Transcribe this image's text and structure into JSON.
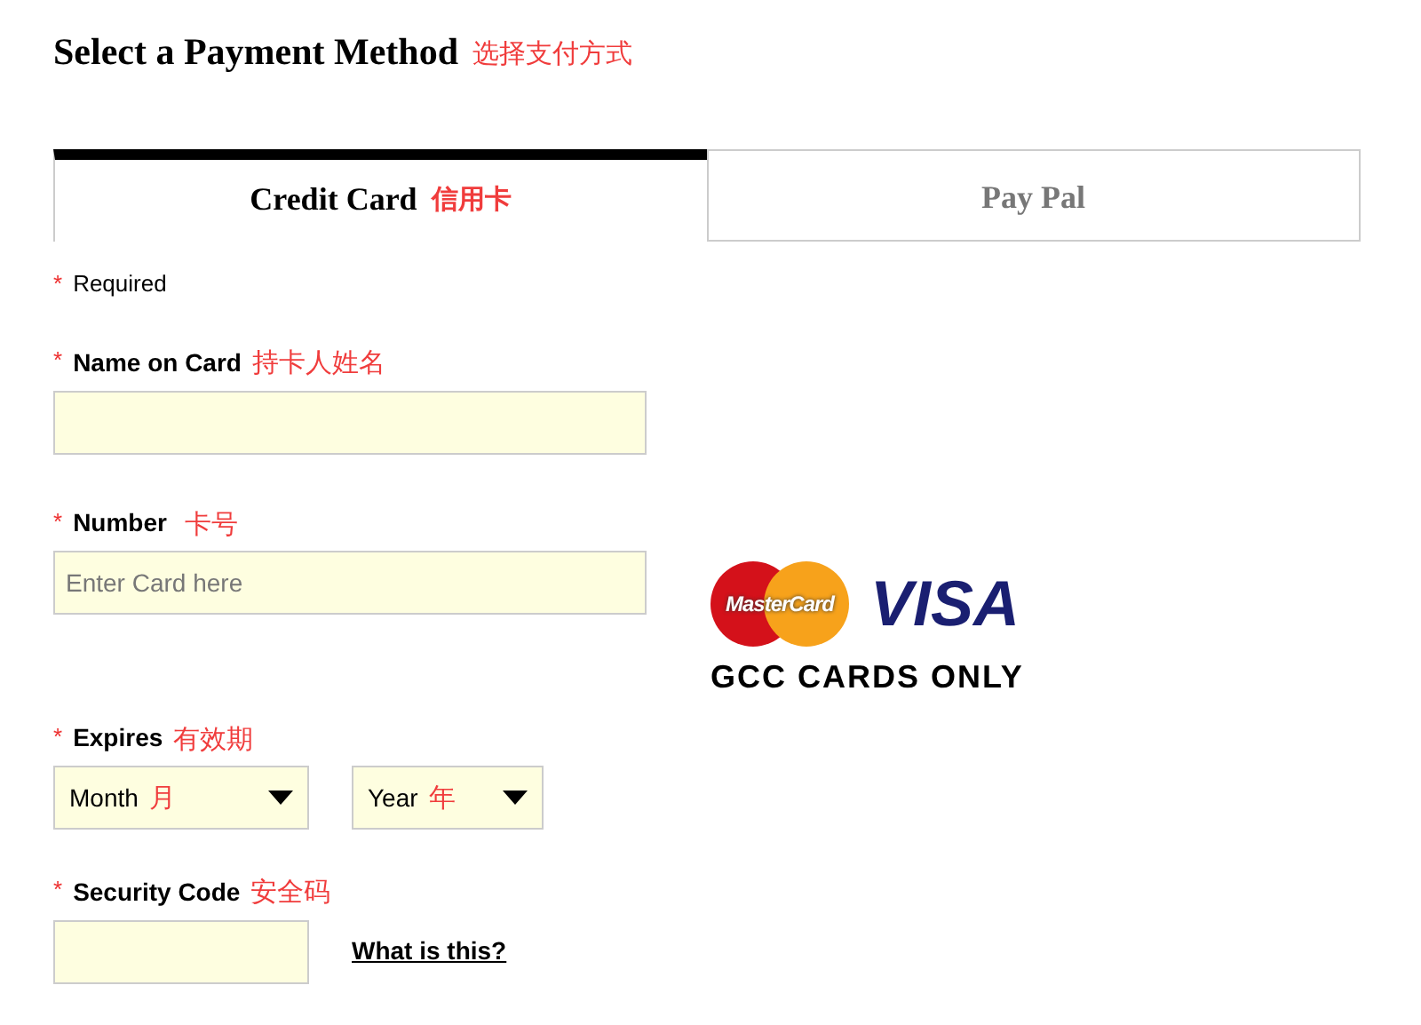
{
  "title": {
    "text": "Select a Payment Method",
    "note": "选择支付方式"
  },
  "tabs": [
    {
      "label": "Credit Card",
      "note": "信用卡",
      "selected": true
    },
    {
      "label": "Pay Pal",
      "selected": false
    }
  ],
  "required_legend": {
    "mark": "*",
    "text": "Required"
  },
  "name_field": {
    "mark": "*",
    "label": "Name on Card",
    "note": "持卡人姓名"
  },
  "number_field": {
    "mark": "*",
    "label": "Number",
    "note": "卡号",
    "placeholder": "Enter Card here"
  },
  "card_logo": {
    "mastercard": "MasterCard",
    "visa": "VISA",
    "caption": "GCC CARDS ONLY"
  },
  "expires": {
    "mark": "*",
    "label": "Expires",
    "note": "有效期",
    "selects": [
      {
        "text": "Month",
        "note": "月"
      },
      {
        "text": "Year",
        "note": "年"
      }
    ]
  },
  "security_field": {
    "mark": "*",
    "label": "Security Code",
    "note": "安全码",
    "link": "What is this?"
  }
}
